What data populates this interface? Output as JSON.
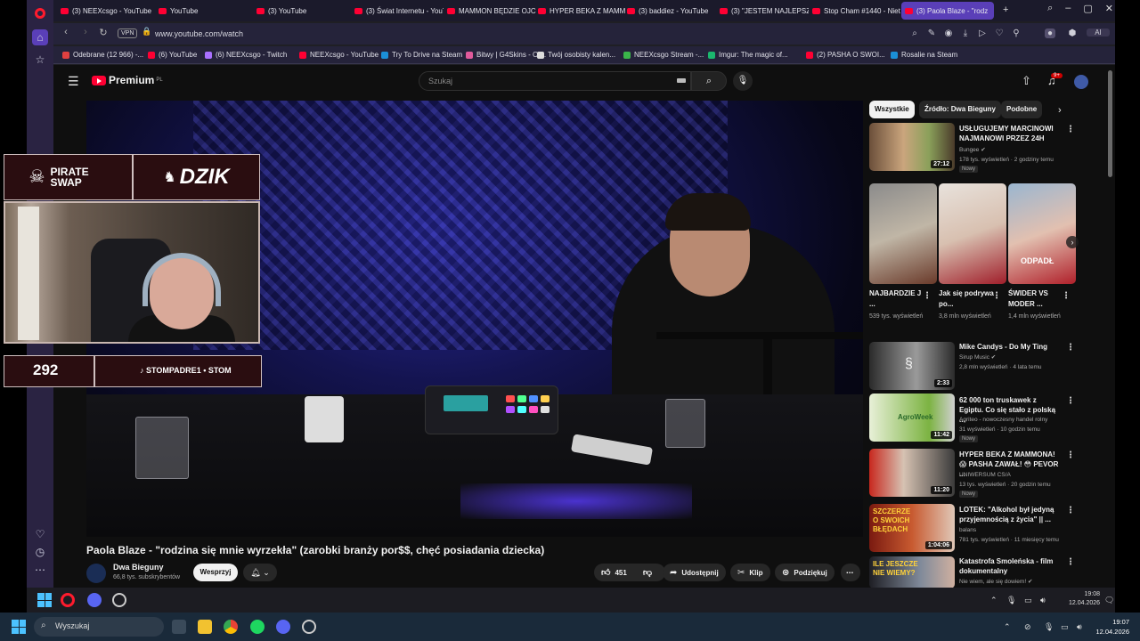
{
  "browser": {
    "tabs": [
      {
        "label": "(3) NEEXcsgo - YouTube",
        "kind": "yt"
      },
      {
        "label": "YouTube",
        "kind": "yt"
      },
      {
        "label": "(3) YouTube",
        "kind": "yt"
      },
      {
        "label": "(3) Świat Internetu - YouT",
        "kind": "yt"
      },
      {
        "label": "MAMMON BĘDZIE OJCE",
        "kind": "yt"
      },
      {
        "label": "HYPER BEKA Z MAMMO",
        "kind": "yt"
      },
      {
        "label": "(3) baddiez - YouTube",
        "kind": "yt"
      },
      {
        "label": "(3) \"JESTEM NAJLEPSZY",
        "kind": "yt"
      },
      {
        "label": "Stop Cham #1440 - Niet",
        "kind": "yt"
      },
      {
        "label": "(3) Paola Blaze - \"rodz",
        "kind": "yt",
        "active": true
      }
    ],
    "url": "www.youtube.com/watch",
    "vpn_label": "VPN",
    "ai_label": "AI",
    "bookmarks": [
      {
        "label": "Odebrane (12 966) -...",
        "color": "#e04040"
      },
      {
        "label": "(6) YouTube",
        "color": "#ff0033"
      },
      {
        "label": "(6) NEEXcsgo - Twitch",
        "color": "#a970ff"
      },
      {
        "label": "NEEXcsgo - YouTube",
        "color": "#ff0033"
      },
      {
        "label": "Try To Drive na Steam",
        "color": "#1b8fd6"
      },
      {
        "label": "Bitwy | G4Skins - Ot...",
        "color": "#e05a9b"
      },
      {
        "label": "Twój osobisty kalen...",
        "color": "#dddddd"
      },
      {
        "label": "NEEXcsgo Stream -...",
        "color": "#3ab54a"
      },
      {
        "label": "Imgur: The magic of...",
        "color": "#1bb76e"
      },
      {
        "label": "(2) PASHA O SWOI...",
        "color": "#ff0033"
      },
      {
        "label": "Rosalie na Steam",
        "color": "#1b8fd6"
      }
    ]
  },
  "youtube": {
    "logo": "Premium",
    "logo_region": "PL",
    "search_placeholder": "Szukaj",
    "notification_count": "9+",
    "video": {
      "title": "Paola Blaze - \"rodzina się mnie wyrzekła\" (zarobki branży por$$, chęć posiadania dziecka)",
      "channel": "Dwa Bieguny",
      "subscribers": "66,8 tys. subskrybentów",
      "support_label": "Wesprzyj",
      "likes": "451",
      "share_label": "Udostępnij",
      "clip_label": "Klip",
      "thanks_label": "Podziękuj"
    },
    "chips": [
      "Wszystkie",
      "Źródło: Dwa Bieguny",
      "Podobne"
    ],
    "recommended_top": {
      "title": "USŁUGUJEMY MARCINOWI NAJMANOWI PRZEZ 24H",
      "channel": "Bungee",
      "meta": "178 tys. wyświetleń · 2 godziny temu",
      "badge": "Nowy",
      "duration": "27:12"
    },
    "shorts": [
      {
        "title": "NAJBARDZIE J ...",
        "views": "539 tys. wyświetleń"
      },
      {
        "title": "Jak się podrywa po...",
        "views": "3,8 mln wyświetleń"
      },
      {
        "title": "ŚWIDER VS MODER ...",
        "views": "1,4 mln wyświetleń",
        "overlay": "ODPADŁ"
      }
    ],
    "recommended": [
      {
        "title": "Mike Candys - Do My Ting",
        "channel": "Sirup Music",
        "meta": "2,8 mln wyświetleń · 4 lata temu",
        "duration": "2:33",
        "badge": ""
      },
      {
        "title": "62 000 ton truskawek z Egiptu. Co się stało z polską ...",
        "channel": "Agriteo - nowoczesny handel rolny",
        "meta": "31 wyświetleń · 10 godzin temu",
        "duration": "11:42",
        "badge": "Nowy",
        "thumb_text": "AgroWeek"
      },
      {
        "title": "HYPER BEKA Z MAMMONA! 😱 PASHA ZAWAŁ! 😳 PEVOR ...",
        "channel": "UNIWERSUM CS/A",
        "meta": "13 tys. wyświetleń · 20 godzin temu",
        "duration": "11:20",
        "badge": "Nowy"
      },
      {
        "title": "LOTEK: \"Alkohol był jedyną przyjemnością z życia\" || ...",
        "channel": "balans",
        "meta": "781 tys. wyświetleń · 11 miesięcy temu",
        "duration": "1:04:06",
        "badge": "",
        "thumb_text": "SZCZERZE O SWOICH BŁĘDACH"
      },
      {
        "title": "Katastrofa Smoleńska - film dokumentalny",
        "channel": "Nie wiem, ale się dowiem!",
        "meta": "",
        "duration": "",
        "badge": "",
        "thumb_text": "ILE JESZCZE NIE WIEMY?"
      }
    ]
  },
  "stream_overlay": {
    "sponsor_left": "PIRATE SWAP",
    "sponsor_right": "DZIK",
    "counter": "292",
    "social": "STOMPADRE1 • STOM"
  },
  "inner_taskbar": {
    "time": "19:08",
    "date": "12.04.2026"
  },
  "taskbar": {
    "search_placeholder": "Wyszukaj",
    "time": "19:07",
    "date": "12.04.2026"
  }
}
